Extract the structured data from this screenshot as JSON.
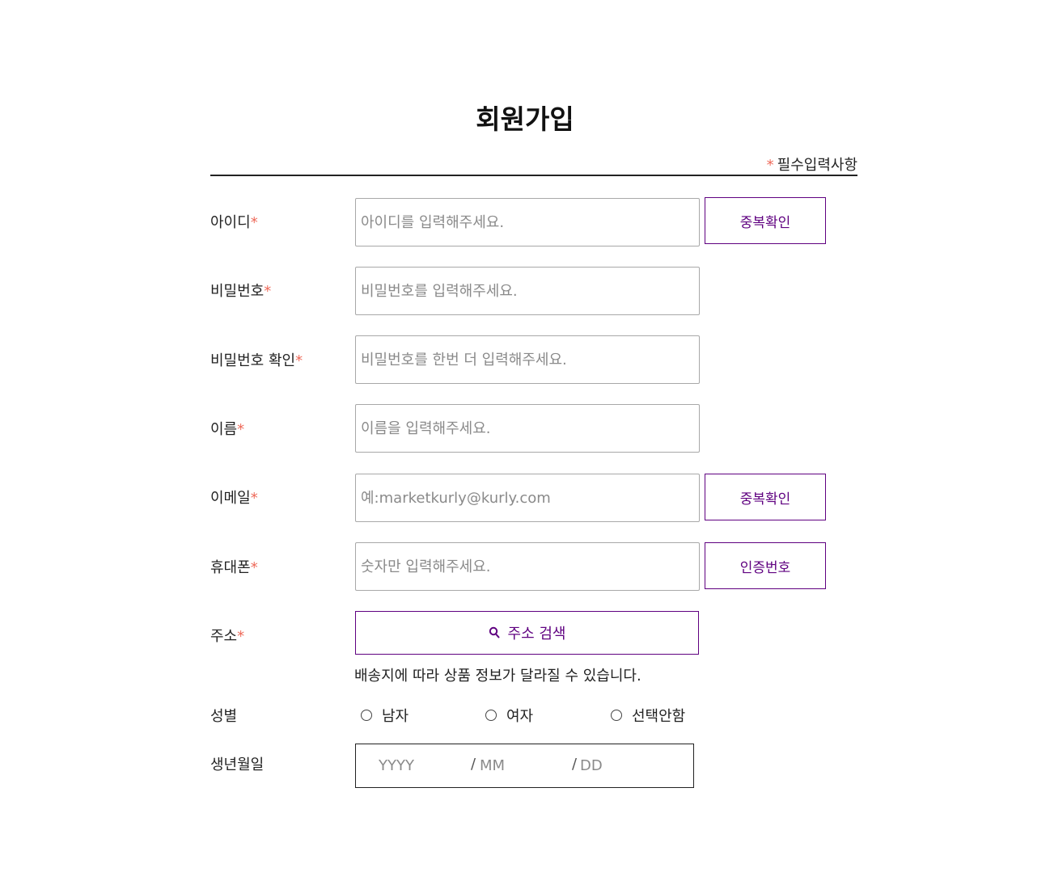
{
  "page": {
    "title": "회원가입",
    "required_star": "*",
    "required_note": "필수입력사항"
  },
  "form": {
    "id": {
      "label": "아이디",
      "required": "*",
      "placeholder": "아이디를 입력해주세요.",
      "button": "중복확인"
    },
    "password": {
      "label": "비밀번호",
      "required": "*",
      "placeholder": "비밀번호를 입력해주세요."
    },
    "password_confirm": {
      "label": "비밀번호 확인",
      "required": "*",
      "placeholder": "비밀번호를 한번 더 입력해주세요."
    },
    "name": {
      "label": "이름",
      "required": "*",
      "placeholder": "이름을 입력해주세요."
    },
    "email": {
      "label": "이메일",
      "required": "*",
      "placeholder": "예:marketkurly@kurly.com",
      "button": "중복확인"
    },
    "phone": {
      "label": "휴대폰",
      "required": "*",
      "placeholder": "숫자만 입력해주세요.",
      "button": "인증번호"
    },
    "address": {
      "label": "주소",
      "required": "*",
      "button": "주소 검색",
      "helper": "배송지에 따라 상품 정보가 달라질 수 있습니다."
    },
    "gender": {
      "label": "성별",
      "options": [
        "남자",
        "여자",
        "선택안함"
      ]
    },
    "birthday": {
      "label": "생년월일",
      "year_placeholder": "YYYY",
      "month_placeholder": "MM",
      "day_placeholder": "DD",
      "separator": "/"
    }
  },
  "colors": {
    "brand": "#5f0080",
    "required": "#ee6a5a",
    "border": "#a8a8a8",
    "text": "#222222"
  },
  "icons": {
    "address_button": "search-icon"
  }
}
